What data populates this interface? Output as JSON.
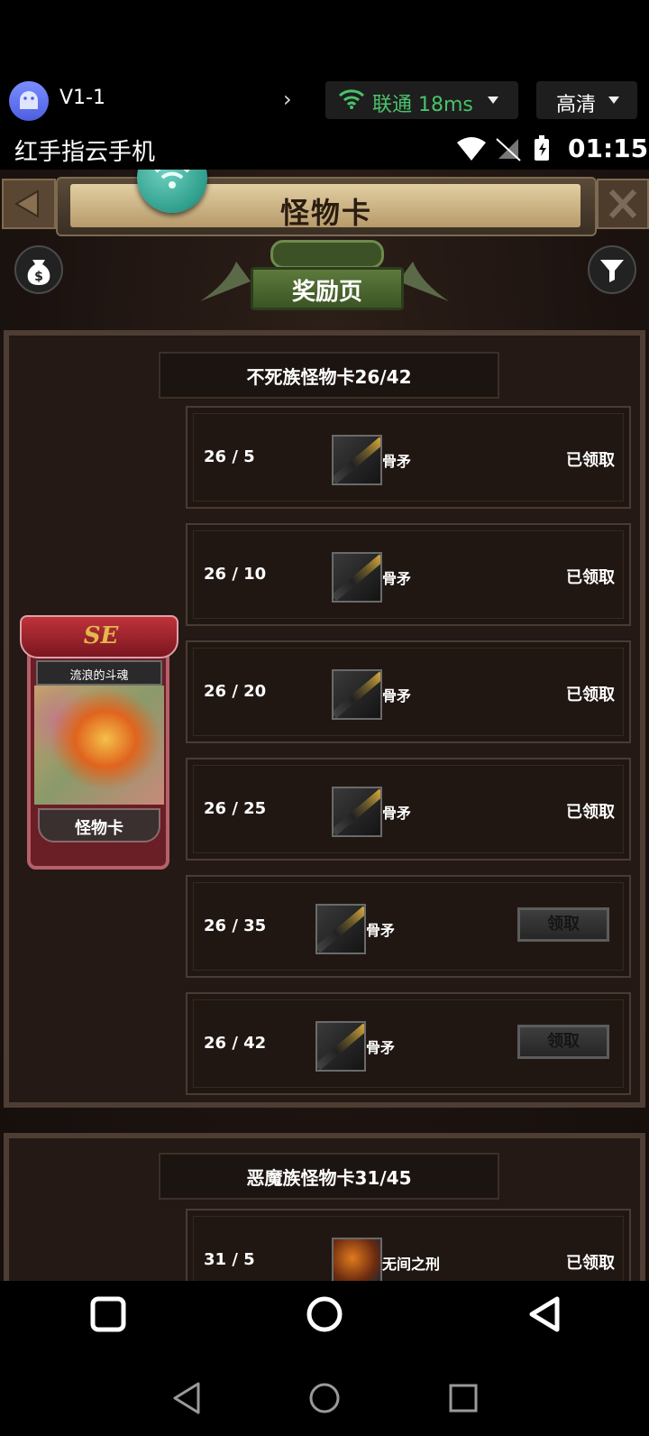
{
  "cloud_bar": {
    "device_name": "V1-1",
    "network_label": "联通 18ms",
    "quality_label": "高清",
    "colors": {
      "network": "#49c26a"
    }
  },
  "status_bar": {
    "carrier": "红手指云手机",
    "time": "01:15"
  },
  "game": {
    "title": "怪物卡",
    "reward_page_label": "奖励页",
    "icons": {
      "back": "triangle-left-icon",
      "close": "close-x-icon",
      "money": "money-bag-icon",
      "filter": "filter-funnel-icon",
      "floating": "wifi-icon"
    },
    "card": {
      "rank": "SE",
      "name": "流浪的斗魂",
      "type": "怪物卡"
    },
    "sections": [
      {
        "title": "不死族怪物卡26/42",
        "rows": [
          {
            "progress": "26 / 5",
            "item": "骨矛",
            "status": "已领取"
          },
          {
            "progress": "26 / 10",
            "item": "骨矛",
            "status": "已领取"
          },
          {
            "progress": "26 / 20",
            "item": "骨矛",
            "status": "已领取"
          },
          {
            "progress": "26 / 25",
            "item": "骨矛",
            "status": "已领取"
          },
          {
            "progress": "26 / 35",
            "item": "骨矛",
            "button": "领取"
          },
          {
            "progress": "26 / 42",
            "item": "骨矛",
            "button": "领取"
          }
        ]
      },
      {
        "title": "恶魔族怪物卡31/45",
        "rows": [
          {
            "progress": "31 / 5",
            "item": "无间之刑",
            "status": "已领取"
          }
        ]
      }
    ]
  }
}
